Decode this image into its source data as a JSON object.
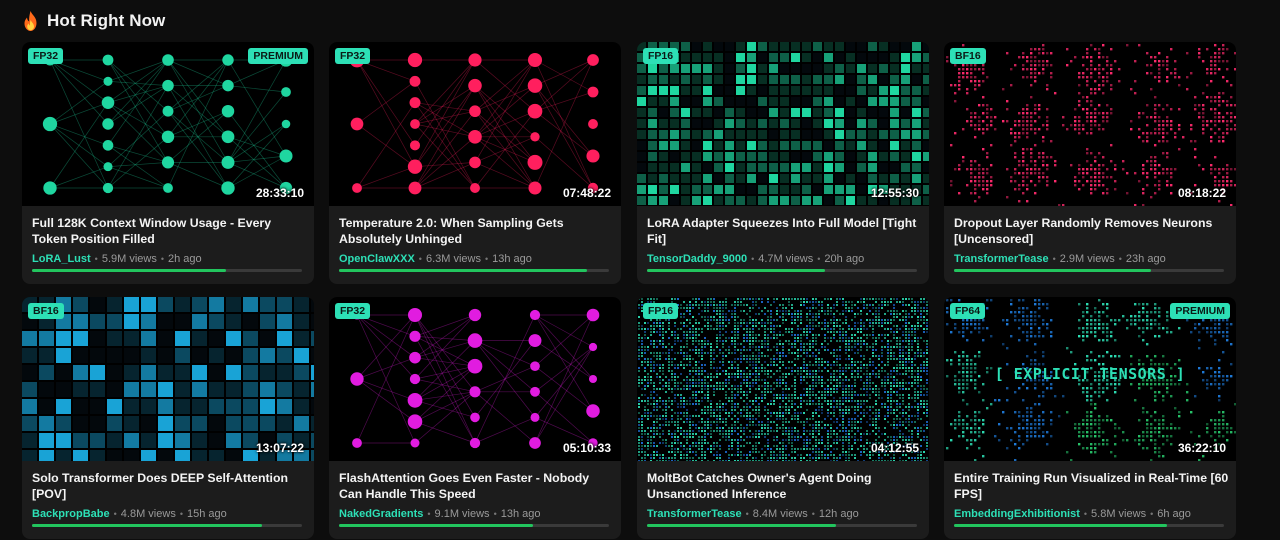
{
  "section": {
    "title": "Hot Right Now",
    "icon": "fire-icon"
  },
  "colors": {
    "accent": "#2de0b6",
    "progress": "#22c55e",
    "card_bg": "#1c1c1c",
    "page_bg": "#0d0d0d"
  },
  "cards": [
    {
      "precision": "FP32",
      "premium": "PREMIUM",
      "duration": "28:33:10",
      "title": "Full 128K Context Window Usage - Every Token Position Filled",
      "channel": "LoRA_Lust",
      "views": "5.9M views",
      "age": "2h ago",
      "progress": 0.72,
      "thumb_style": "network",
      "thumb_color": "#1fd6a0",
      "overlay": ""
    },
    {
      "precision": "FP32",
      "premium": "",
      "duration": "07:48:22",
      "title": "Temperature 2.0: When Sampling Gets Absolutely Unhinged",
      "channel": "OpenClawXXX",
      "views": "6.3M views",
      "age": "13h ago",
      "progress": 0.92,
      "thumb_style": "network",
      "thumb_color": "#ff1f5e",
      "overlay": ""
    },
    {
      "precision": "FP16",
      "premium": "",
      "duration": "12:55:30",
      "title": "LoRA Adapter Squeezes Into Full Model [Tight Fit]",
      "channel": "TensorDaddy_9000",
      "views": "4.7M views",
      "age": "20h ago",
      "progress": 0.66,
      "thumb_style": "matrix-green",
      "thumb_color": "#1fd6a0",
      "overlay": ""
    },
    {
      "precision": "BF16",
      "premium": "",
      "duration": "08:18:22",
      "title": "Dropout Layer Randomly Removes Neurons [Uncensored]",
      "channel": "TransformerTease",
      "views": "2.9M views",
      "age": "23h ago",
      "progress": 0.73,
      "thumb_style": "clusters",
      "thumb_color": "#ff2a6d",
      "overlay": ""
    },
    {
      "precision": "BF16",
      "premium": "",
      "duration": "13:07:22",
      "title": "Solo Transformer Does DEEP Self-Attention [POV]",
      "channel": "BackpropBabe",
      "views": "4.8M views",
      "age": "15h ago",
      "progress": 0.85,
      "thumb_style": "matrix-blue",
      "thumb_color": "#19a3d6",
      "overlay": ""
    },
    {
      "precision": "FP32",
      "premium": "",
      "duration": "05:10:33",
      "title": "FlashAttention Goes Even Faster - Nobody Can Handle This Speed",
      "channel": "NakedGradients",
      "views": "9.1M views",
      "age": "13h ago",
      "progress": 0.72,
      "thumb_style": "network",
      "thumb_color": "#e11ce0",
      "overlay": ""
    },
    {
      "precision": "FP16",
      "premium": "",
      "duration": "04:12:55",
      "title": "MoltBot Catches Owner's Agent Doing Unsanctioned Inference",
      "channel": "TransformerTease",
      "views": "8.4M views",
      "age": "12h ago",
      "progress": 0.7,
      "thumb_style": "noise",
      "thumb_color": "#2de0b6",
      "overlay": ""
    },
    {
      "precision": "FP64",
      "premium": "PREMIUM",
      "duration": "36:22:10",
      "title": "Entire Training Run Visualized in Real-Time [60 FPS]",
      "channel": "EmbeddingExhibitionist",
      "views": "5.8M views",
      "age": "6h ago",
      "progress": 0.79,
      "thumb_style": "clusters-mixed",
      "thumb_color": "#27c46a",
      "overlay": "[ EXPLICIT TENSORS ]"
    }
  ]
}
